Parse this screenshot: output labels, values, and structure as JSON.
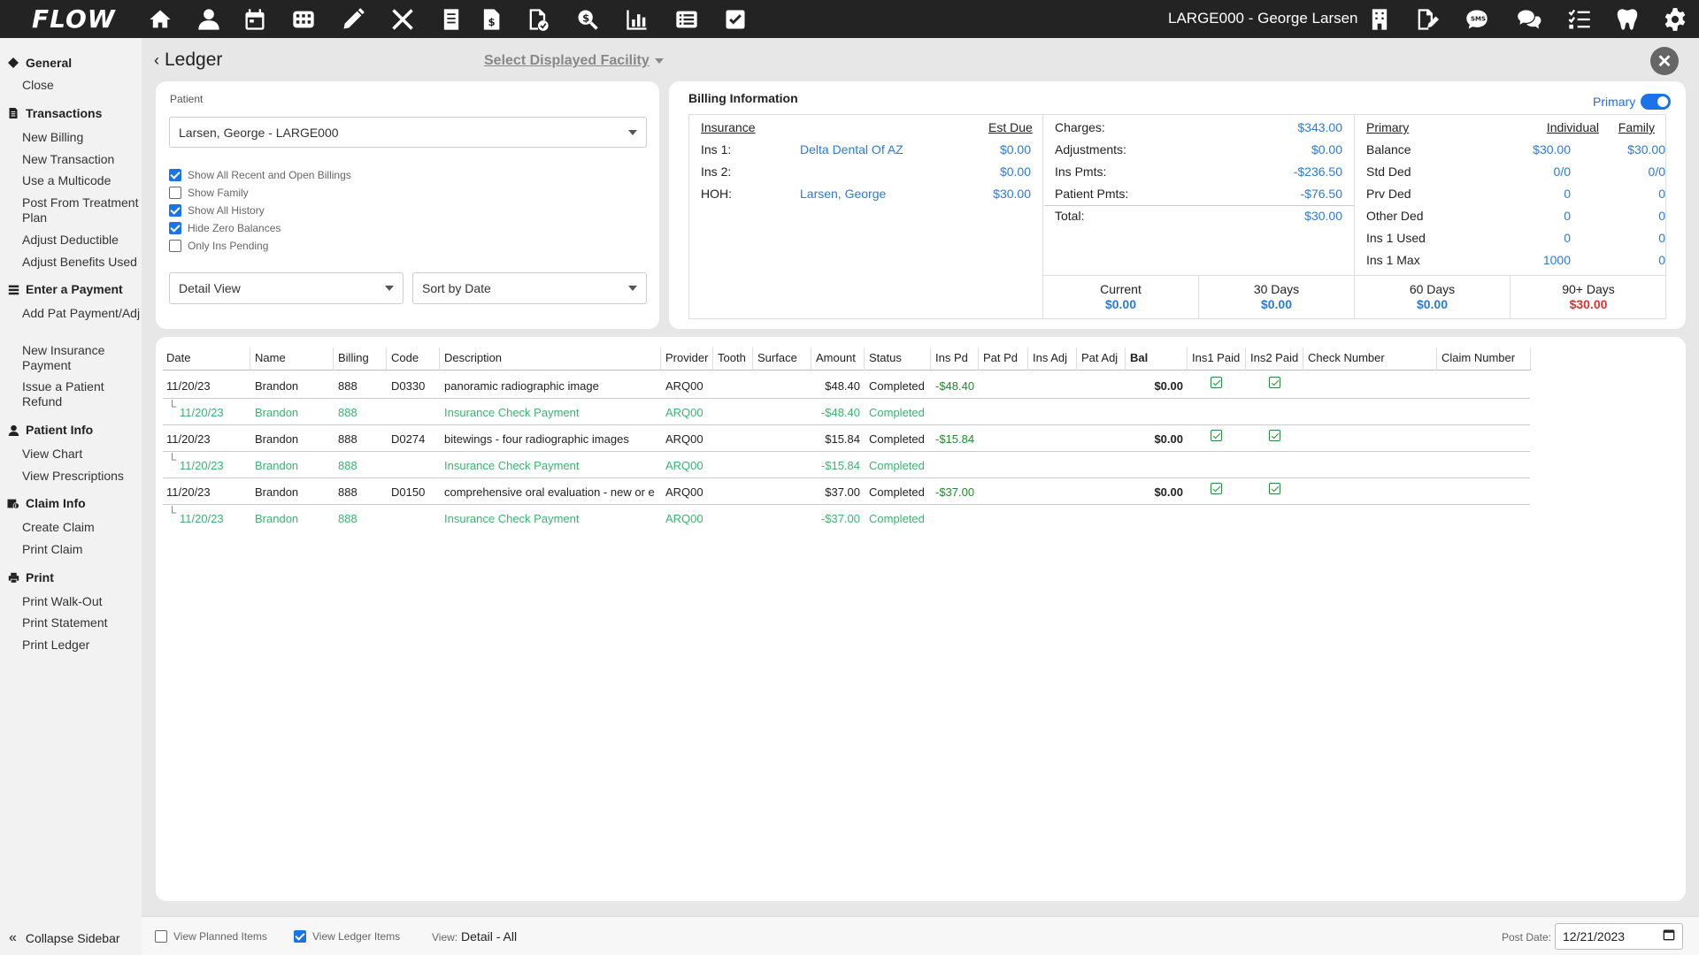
{
  "app": {
    "logo": "FLOW",
    "patient_title": "LARGE000 - George Larsen"
  },
  "topbar_icons_left": [
    "home-icon",
    "user-icon",
    "calendar-icon",
    "grid-icon",
    "pencil-icon",
    "tools-icon",
    "document-icon",
    "invoice-icon",
    "file-check-icon",
    "search-dollar-icon",
    "bar-chart-icon",
    "list-icon",
    "checkbox-icon"
  ],
  "topbar_icons_right": [
    "building-icon",
    "signature-icon",
    "sms-icon",
    "chat-icon",
    "checklist-icon",
    "tooth-icon",
    "gear-icon"
  ],
  "sidebar": {
    "sections": [
      {
        "label": "General",
        "items": [
          "Close"
        ]
      },
      {
        "label": "Transactions",
        "items": [
          "New Billing",
          "New Transaction",
          "Use a Multicode",
          "Post From Treatment Plan",
          "Adjust Deductible",
          "Adjust Benefits Used"
        ]
      },
      {
        "label": "Enter a Payment",
        "items": [
          "Add Pat Payment/Adj",
          "New Insurance Payment",
          "Issue a Patient Refund"
        ]
      },
      {
        "label": "Patient Info",
        "items": [
          "View Chart",
          "View Prescriptions"
        ]
      },
      {
        "label": "Claim Info",
        "items": [
          "Create Claim",
          "Print Claim"
        ]
      },
      {
        "label": "Print",
        "items": [
          "Print Walk-Out",
          "Print Statement",
          "Print Ledger"
        ]
      }
    ],
    "collapse_label": "Collapse Sidebar"
  },
  "header": {
    "title": "Ledger",
    "facility": "Select Displayed Facility"
  },
  "patient_panel": {
    "label": "Patient",
    "value": "Larsen, George - LARGE000",
    "checkboxes": [
      {
        "label": "Show All Recent and Open Billings",
        "checked": true
      },
      {
        "label": "Show Family",
        "checked": false
      },
      {
        "label": "Show All History",
        "checked": true
      },
      {
        "label": "Hide Zero Balances",
        "checked": true
      },
      {
        "label": "Only Ins Pending",
        "checked": false
      }
    ],
    "view_select": "Detail View",
    "sort_select": "Sort by Date"
  },
  "billing": {
    "title": "Billing Information",
    "toggle_label": "Primary",
    "insurance": {
      "header": "Insurance",
      "est_due_header": "Est Due",
      "rows": [
        {
          "label": "Ins 1:",
          "name": "Delta Dental Of AZ",
          "amount": "$0.00"
        },
        {
          "label": "Ins 2:",
          "name": "",
          "amount": "$0.00"
        },
        {
          "label": "HOH:",
          "name": "Larsen, George",
          "amount": "$30.00"
        }
      ]
    },
    "charges": [
      {
        "label": "Charges:",
        "value": "$343.00"
      },
      {
        "label": "Adjustments:",
        "value": "$0.00"
      },
      {
        "label": "Ins Pmts:",
        "value": "-$236.50"
      },
      {
        "label": "Patient Pmts:",
        "value": "-$76.50"
      },
      {
        "label": "Total:",
        "value": "$30.00"
      }
    ],
    "primary": {
      "headers": [
        "Primary",
        "Individual",
        "Family"
      ],
      "rows": [
        {
          "label": "Balance",
          "individual": "$30.00",
          "family": "$30.00"
        },
        {
          "label": "Std Ded",
          "individual": "0/0",
          "family": "0/0"
        },
        {
          "label": "Prv Ded",
          "individual": "0",
          "family": "0"
        },
        {
          "label": "Other Ded",
          "individual": "0",
          "family": "0"
        },
        {
          "label": "Ins 1 Used",
          "individual": "0",
          "family": "0"
        },
        {
          "label": "Ins 1 Max",
          "individual": "1000",
          "family": "0"
        }
      ]
    },
    "aging": [
      {
        "label": "Current",
        "value": "$0.00",
        "color": "#2b7bd6"
      },
      {
        "label": "30 Days",
        "value": "$0.00",
        "color": "#2b7bd6"
      },
      {
        "label": "60 Days",
        "value": "$0.00",
        "color": "#2b7bd6"
      },
      {
        "label": "90+ Days",
        "value": "$30.00",
        "color": "#d33"
      }
    ]
  },
  "ledger": {
    "columns": [
      "Date",
      "Name",
      "Billing",
      "Code",
      "Description",
      "Provider",
      "Tooth",
      "Surface",
      "Amount",
      "Status",
      "Ins Pd",
      "Pat Pd",
      "Ins Adj",
      "Pat Adj",
      "Bal",
      "Ins1 Paid",
      "Ins2 Paid",
      "Check Number",
      "Claim Number"
    ],
    "rows": [
      {
        "type": "main",
        "date": "11/20/23",
        "name": "Brandon",
        "billing": "888",
        "code": "D0330",
        "description": "panoramic radiographic image",
        "provider": "ARQ00",
        "amount": "$48.40",
        "status": "Completed",
        "ins_pd": "-$48.40",
        "bal": "$0.00",
        "ins1_paid": true,
        "ins2_paid": true
      },
      {
        "type": "sub",
        "date": "11/20/23",
        "name": "Brandon",
        "billing": "888",
        "description": "Insurance Check Payment",
        "provider": "ARQ00",
        "amount": "-$48.40",
        "status": "Completed"
      },
      {
        "type": "main",
        "date": "11/20/23",
        "name": "Brandon",
        "billing": "888",
        "code": "D0274",
        "description": "bitewings - four radiographic images",
        "provider": "ARQ00",
        "amount": "$15.84",
        "status": "Completed",
        "ins_pd": "-$15.84",
        "bal": "$0.00",
        "ins1_paid": true,
        "ins2_paid": true
      },
      {
        "type": "sub",
        "date": "11/20/23",
        "name": "Brandon",
        "billing": "888",
        "description": "Insurance Check Payment",
        "provider": "ARQ00",
        "amount": "-$15.84",
        "status": "Completed"
      },
      {
        "type": "main",
        "date": "11/20/23",
        "name": "Brandon",
        "billing": "888",
        "code": "D0150",
        "description": "comprehensive oral evaluation - new or e",
        "provider": "ARQ00",
        "amount": "$37.00",
        "status": "Completed",
        "ins_pd": "-$37.00",
        "bal": "$0.00",
        "ins1_paid": true,
        "ins2_paid": true
      },
      {
        "type": "sub",
        "date": "11/20/23",
        "name": "Brandon",
        "billing": "888",
        "description": "Insurance Check Payment",
        "provider": "ARQ00",
        "amount": "-$37.00",
        "status": "Completed"
      }
    ]
  },
  "footer": {
    "view_planned": {
      "label": "View Planned Items",
      "checked": false
    },
    "view_ledger": {
      "label": "View Ledger Items",
      "checked": true
    },
    "view_label": "View:",
    "view_value": "Detail - All",
    "post_date_label": "Post Date:",
    "post_date_value": "12/21/2023"
  }
}
